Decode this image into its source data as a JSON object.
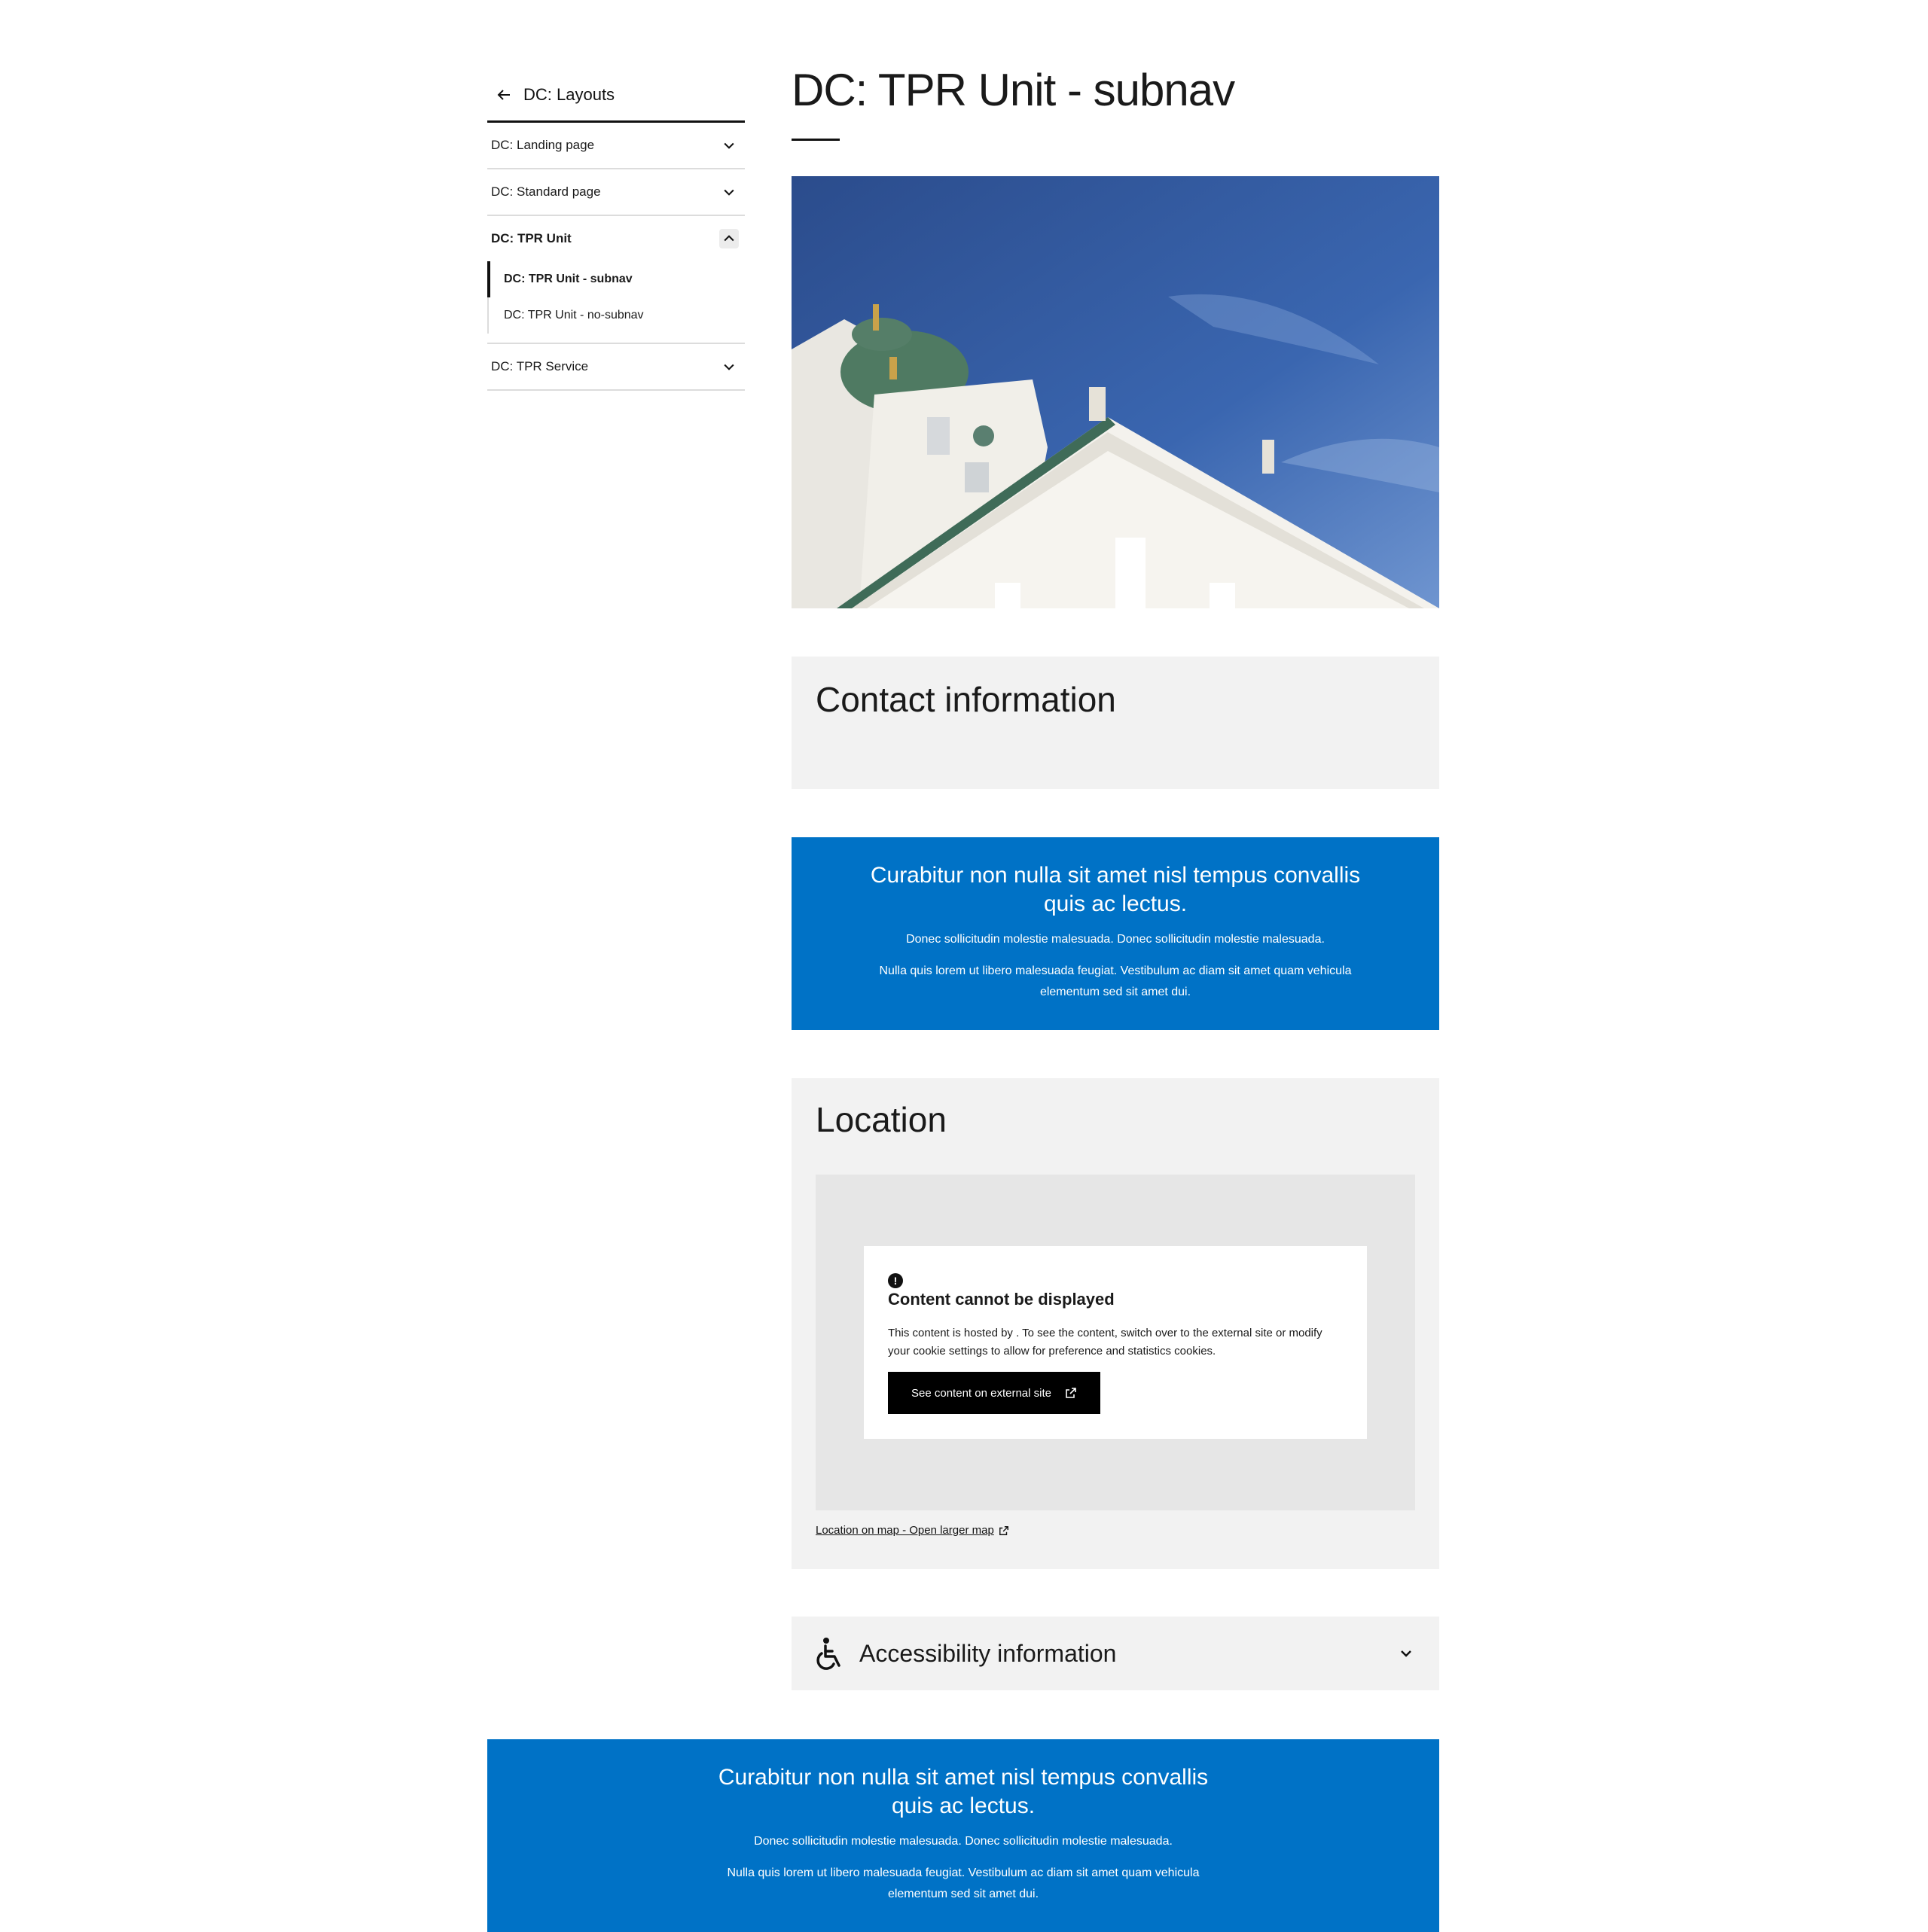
{
  "sidenav": {
    "back_label": "DC: Layouts",
    "items": [
      {
        "label": "DC: Landing page"
      },
      {
        "label": "DC: Standard page"
      },
      {
        "label": "DC: TPR Unit"
      },
      {
        "label": "DC: TPR Service"
      }
    ],
    "subitems": [
      {
        "label": "DC: TPR Unit - subnav"
      },
      {
        "label": "DC: TPR Unit - no-subnav"
      }
    ]
  },
  "page": {
    "title": "DC: TPR Unit - subnav"
  },
  "contact": {
    "heading": "Contact information"
  },
  "banner1": {
    "heading": "Curabitur non nulla sit amet nisl tempus convallis quis ac lectus.",
    "p1": "Donec sollicitudin molestie malesuada. Donec sollicitudin molestie malesuada.",
    "p2": "Nulla quis lorem ut libero malesuada feugiat. Vestibulum ac diam sit amet quam vehicula elementum sed sit amet dui."
  },
  "location": {
    "heading": "Location",
    "notice_title": "Content cannot be displayed",
    "notice_text": "This content is hosted by . To see the content, switch over to the external site or modify your cookie settings to allow for preference and statistics cookies.",
    "button_label": "See content on external site",
    "map_link": "Location on map - Open larger map"
  },
  "accessibility": {
    "label": "Accessibility information"
  },
  "banner2": {
    "heading": "Curabitur non nulla sit amet nisl tempus convallis quis ac lectus.",
    "p1": "Donec sollicitudin molestie malesuada. Donec sollicitudin molestie malesuada.",
    "p2": "Nulla quis lorem ut libero malesuada feugiat. Vestibulum ac diam sit amet quam vehicula elementum sed sit amet dui."
  },
  "icons": {
    "back": "arrow-left-icon",
    "expand": "chevron-down-icon",
    "collapse": "chevron-up-icon",
    "external": "external-link-icon",
    "alert": "alert-icon",
    "accessibility": "wheelchair-icon"
  },
  "colors": {
    "accent_blue": "#0072c6",
    "panel_grey": "#f2f2f2"
  }
}
